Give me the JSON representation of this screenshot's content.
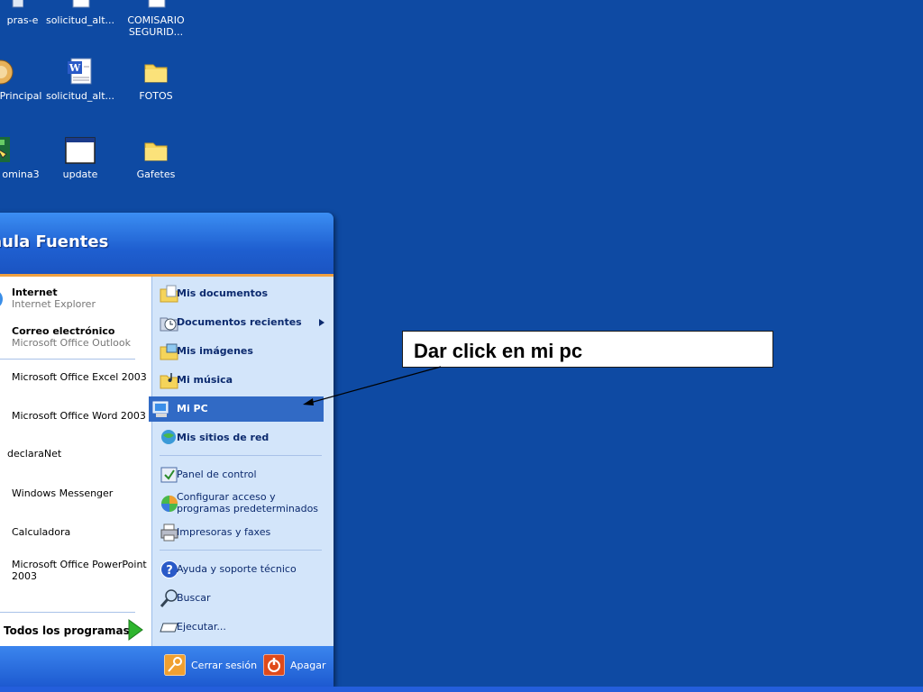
{
  "desktop": {
    "icons": [
      {
        "label": "pras-e"
      },
      {
        "label": "solicitud_alt..."
      },
      {
        "label": "COMISARIO\nSEGURID..."
      },
      {
        "label": "Principal"
      },
      {
        "label": "solicitud_alt..."
      },
      {
        "label": "FOTOS"
      },
      {
        "label": "omina3"
      },
      {
        "label": "update"
      },
      {
        "label": "Gafetes"
      }
    ]
  },
  "start_menu": {
    "user_name": "aula Fuentes",
    "pinned": [
      {
        "title": "Internet",
        "subtitle": "Internet Explorer"
      },
      {
        "title": "Correo electrónico",
        "subtitle": "Microsoft Office Outlook"
      }
    ],
    "recent": [
      {
        "label": "Microsoft Office Excel 2003"
      },
      {
        "label": "Microsoft Office Word 2003"
      },
      {
        "label": "declaraNet"
      },
      {
        "label": "Windows Messenger"
      },
      {
        "label": "Calculadora"
      },
      {
        "label": "Microsoft Office PowerPoint\n2003"
      }
    ],
    "all_programs": "Todos los programas",
    "right": {
      "mis_documentos": "Mis documentos",
      "documentos_recientes": "Documentos recientes",
      "mis_imagenes": "Mis imágenes",
      "mi_musica": "Mi música",
      "mi_pc": "Mi PC",
      "mis_sitios": "Mis sitios de red",
      "panel": "Panel de control",
      "configurar": "Configurar acceso y\nprogramas predeterminados",
      "impresoras": "Impresoras y faxes",
      "ayuda": "Ayuda y soporte técnico",
      "buscar": "Buscar",
      "ejecutar": "Ejecutar..."
    },
    "footer": {
      "logoff": "Cerrar sesión",
      "shutdown": "Apagar"
    }
  },
  "callout": {
    "text": "Dar click en mi pc"
  },
  "colors": {
    "desktop": "#0e4aa3",
    "selection": "#316ac5",
    "header_stripe": "#f0a040"
  }
}
